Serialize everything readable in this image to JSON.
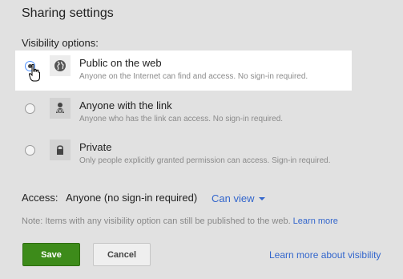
{
  "dialog": {
    "title": "Sharing settings",
    "visibility_label": "Visibility options:"
  },
  "options": [
    {
      "title": "Public on the web",
      "description": "Anyone on the Internet can find and access. No sign-in required.",
      "icon": "globe-icon",
      "selected": true
    },
    {
      "title": "Anyone with the link",
      "description": "Anyone who has the link can access. No sign-in required.",
      "icon": "link-person-icon",
      "selected": false
    },
    {
      "title": "Private",
      "description": "Only people explicitly granted permission can access. Sign-in required.",
      "icon": "lock-icon",
      "selected": false
    }
  ],
  "access": {
    "label": "Access:",
    "value": "Anyone (no sign-in required)",
    "permission": "Can view"
  },
  "note": {
    "text": "Note: Items with any visibility option can still be published to the web.",
    "link": "Learn more"
  },
  "buttons": {
    "save": "Save",
    "cancel": "Cancel"
  },
  "learn_more_visibility": "Learn more about visibility",
  "colors": {
    "background": "#e1e1e1",
    "link": "#3366cc",
    "save_button": "#3d8b1a"
  }
}
